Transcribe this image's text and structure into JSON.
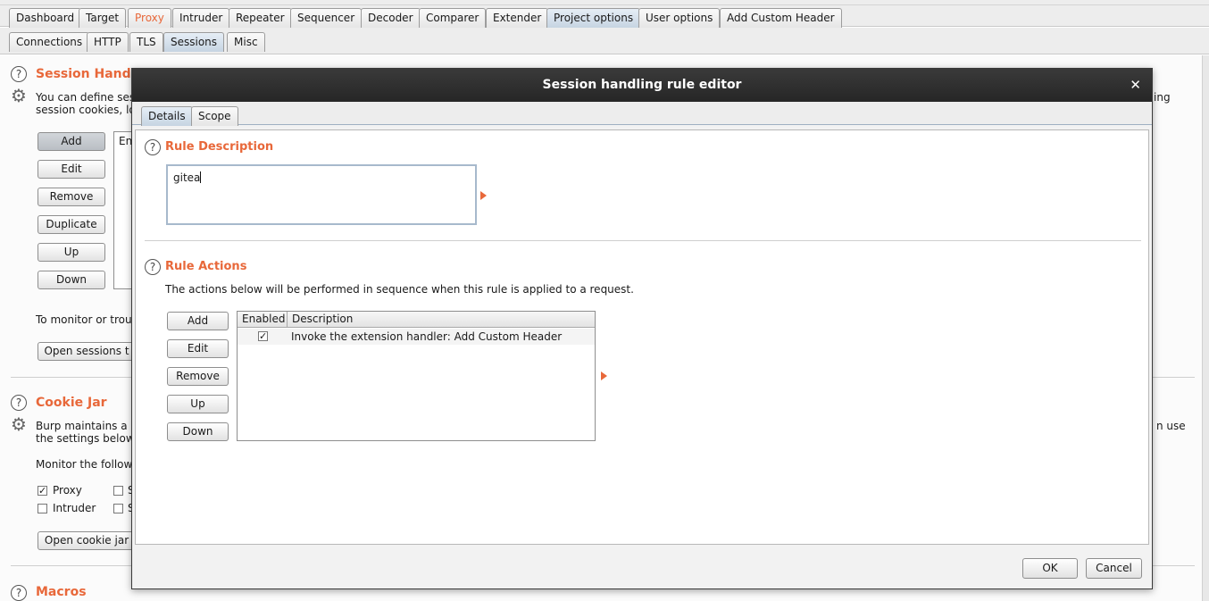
{
  "main_tabs": [
    "Dashboard",
    "Target",
    "Proxy",
    "Intruder",
    "Repeater",
    "Sequencer",
    "Decoder",
    "Comparer",
    "Extender",
    "Project options",
    "User options",
    "Add Custom Header"
  ],
  "sub_tabs": [
    "Connections",
    "HTTP",
    "TLS",
    "Sessions",
    "Misc"
  ],
  "background": {
    "session_handling": {
      "title": "Session Handli",
      "desc_line1_left": "You can define ses",
      "desc_line1_right": "ing",
      "desc_line2": "session cookies, lo",
      "buttons": [
        "Add",
        "Edit",
        "Remove",
        "Duplicate",
        "Up",
        "Down"
      ],
      "table_header_fragment": "En",
      "monitor_text": "To monitor or troul",
      "open_sessions_button": "Open sessions t"
    },
    "cookie_jar": {
      "title": "Cookie Jar",
      "desc_line1_left": "Burp maintains a c",
      "desc_line1_right": "n use",
      "desc_line2": "the settings below",
      "monitor_text": "Monitor the followir",
      "checkboxes": [
        {
          "label": "Proxy",
          "checked": true
        },
        {
          "label": "Intruder",
          "checked": false
        }
      ],
      "checkbox_fragments": [
        "S",
        "S"
      ],
      "open_button": "Open cookie jar"
    },
    "macros": {
      "title": "Macros"
    }
  },
  "dialog": {
    "title": "Session handling rule editor",
    "close_glyph": "✕",
    "tabs": [
      "Details",
      "Scope"
    ],
    "rule_description": {
      "title": "Rule Description",
      "value": "gitea"
    },
    "rule_actions": {
      "title": "Rule Actions",
      "description": "The actions below will be performed in sequence when this rule is applied to a request.",
      "buttons": [
        "Add",
        "Edit",
        "Remove",
        "Up",
        "Down"
      ],
      "columns": [
        "Enabled",
        "Description"
      ],
      "rows": [
        {
          "enabled": true,
          "description": "Invoke the extension handler: Add Custom Header"
        }
      ]
    },
    "ok_label": "OK",
    "cancel_label": "Cancel"
  },
  "colors": {
    "accent": "#e8683a",
    "selected_tab": "#c6d4e2",
    "title_bar": "#262626"
  },
  "icons": [
    "help-icon",
    "gear-icon",
    "close-icon",
    "arrow-right-icon",
    "checkbox-checked-icon"
  ]
}
